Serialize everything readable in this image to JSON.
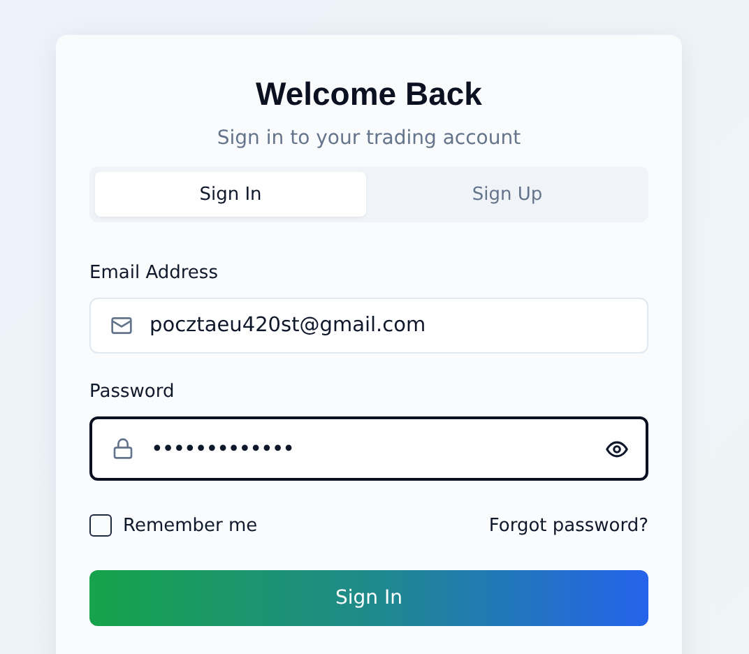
{
  "title": "Welcome Back",
  "subtitle": "Sign in to your trading account",
  "tabs": [
    {
      "label": "Sign In",
      "selected": true
    },
    {
      "label": "Sign Up",
      "selected": false
    }
  ],
  "fields": [
    {
      "label": "Email Address",
      "kind": "email",
      "value": "pocztaeu420st@gmail.com",
      "focused": false
    },
    {
      "label": "Password",
      "kind": "password",
      "value": "•••••••••••••",
      "focused": true
    }
  ],
  "remember": {
    "label": "Remember me",
    "checked": false
  },
  "forgot_link": "Forgot password?",
  "submit_button": "Sign In"
}
